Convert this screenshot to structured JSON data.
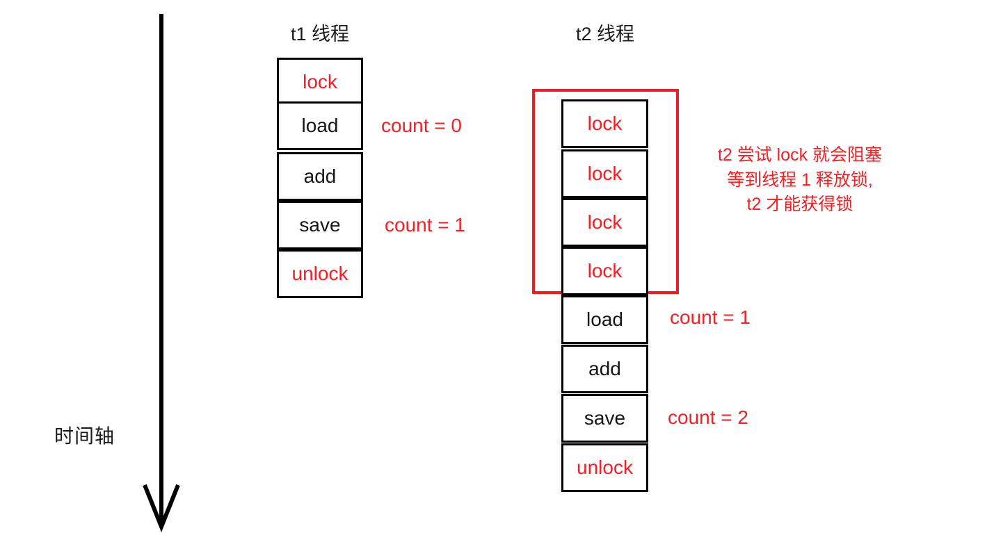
{
  "diagram": {
    "timeline": {
      "label": "时间轴",
      "axis_icon": "down-arrow-icon"
    },
    "columns": [
      {
        "id": "t1",
        "header": "t1 线程",
        "steps": [
          {
            "label": "lock",
            "color": "red",
            "annotation": null
          },
          {
            "label": "load",
            "color": "black",
            "annotation": "count = 0"
          },
          {
            "label": "add",
            "color": "black",
            "annotation": null
          },
          {
            "label": "save",
            "color": "black",
            "annotation": "count = 1"
          },
          {
            "label": "unlock",
            "color": "red",
            "annotation": null
          }
        ]
      },
      {
        "id": "t2",
        "header": "t2 线程",
        "steps": [
          {
            "label": "lock",
            "color": "red",
            "annotation": null
          },
          {
            "label": "lock",
            "color": "red",
            "annotation": null
          },
          {
            "label": "lock",
            "color": "red",
            "annotation": null
          },
          {
            "label": "lock",
            "color": "red",
            "annotation": null
          },
          {
            "label": "load",
            "color": "black",
            "annotation": "count = 1"
          },
          {
            "label": "add",
            "color": "black",
            "annotation": null
          },
          {
            "label": "save",
            "color": "black",
            "annotation": "count = 2"
          },
          {
            "label": "unlock",
            "color": "red",
            "annotation": null
          }
        ]
      }
    ],
    "blocking_region": {
      "note": "t2 尝试 lock 就会阻塞\n等到线程 1 释放锁,\nt2 才能获得锁"
    },
    "colors": {
      "box_border": "#000000",
      "text_black": "#161616",
      "text_red": "#f41f24",
      "region_border": "#ee1d24",
      "background": "#ffffff"
    }
  }
}
